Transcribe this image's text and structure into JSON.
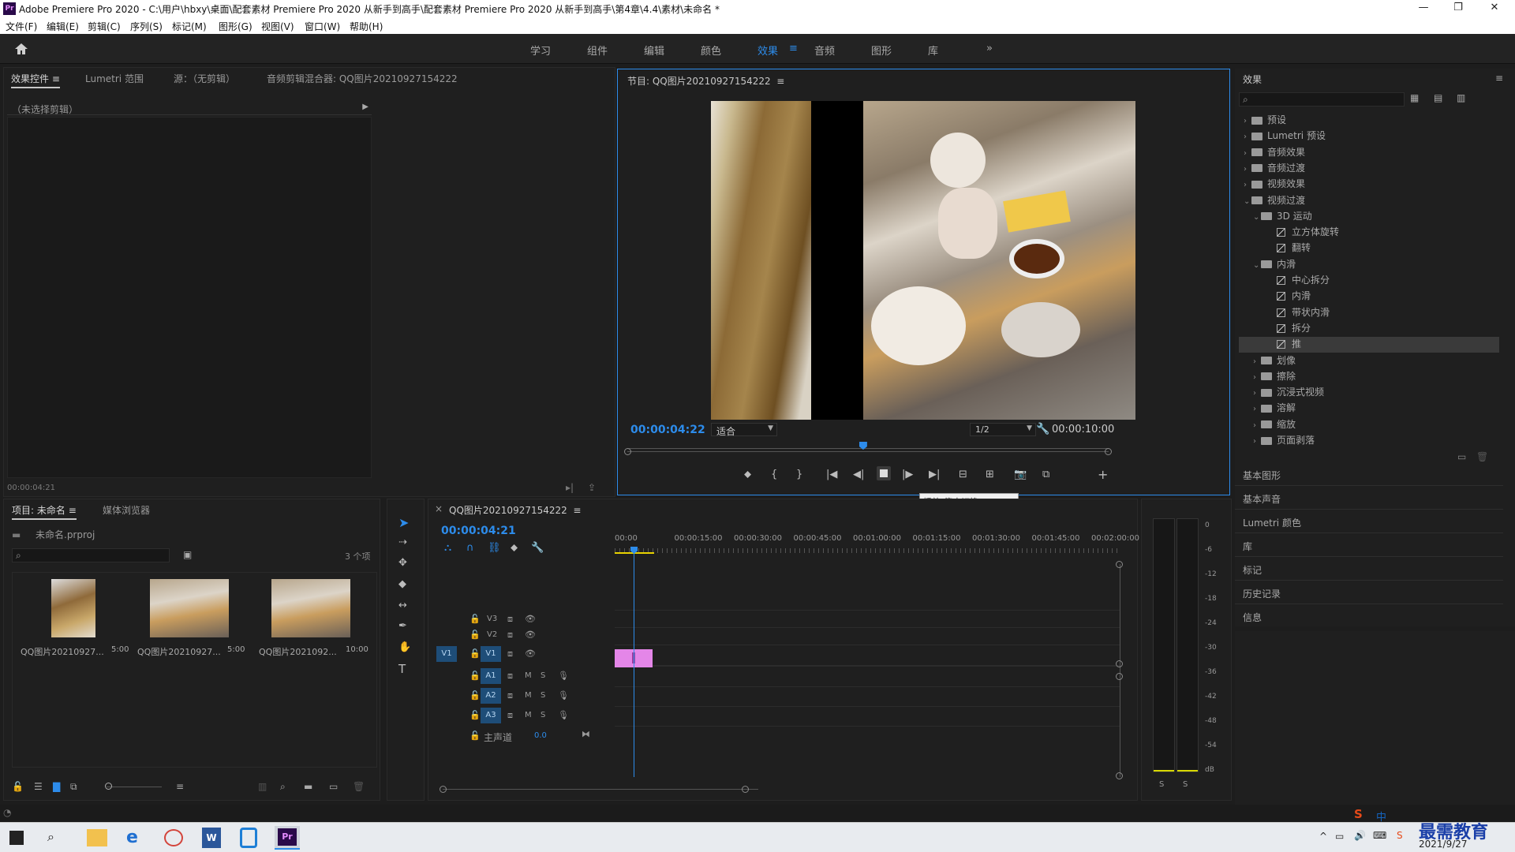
{
  "titlebar": {
    "title": "Adobe Premiere Pro 2020 - C:\\用户\\hbxy\\桌面\\配套素材 Premiere Pro 2020 从新手到高手\\配套素材 Premiere Pro 2020 从新手到高手\\第4章\\4.4\\素材\\未命名 *",
    "logo": "Pr",
    "minimize": "—",
    "restore": "❐",
    "close": "✕"
  },
  "menu": [
    "文件(F)",
    "编辑(E)",
    "剪辑(C)",
    "序列(S)",
    "标记(M)",
    "图形(G)",
    "视图(V)",
    "窗口(W)",
    "帮助(H)"
  ],
  "workspaces": {
    "home_icon": "home-icon",
    "items": [
      "学习",
      "组件",
      "编辑",
      "颜色",
      "效果",
      "音频",
      "图形",
      "库"
    ],
    "active": "效果",
    "overflow": "»",
    "menu_glyph": "≡"
  },
  "left_panel": {
    "tabs": [
      "效果控件",
      "Lumetri 范围",
      "源：（无剪辑）",
      "音频剪辑混合器: QQ图片20210927154222"
    ],
    "menu_glyph": "≡",
    "no_clip": "（未选择剪辑）",
    "timecode": "00:00:04:21"
  },
  "program_monitor": {
    "title": "节目: QQ图片20210927154222",
    "menu_glyph": "≡",
    "current_time": "00:00:04:22",
    "fit": "适合",
    "resolution": "1/2",
    "duration": "00:00:10:00",
    "playhead_fraction": 0.49,
    "tooltip": "播放-停止切换 (Space)"
  },
  "effects_panel": {
    "title": "效果",
    "menu_glyph": "≡",
    "tree": [
      {
        "label": "预设",
        "level": 0,
        "type": "folder-special",
        "expanded": false
      },
      {
        "label": "Lumetri 预设",
        "level": 0,
        "type": "folder-special",
        "expanded": false
      },
      {
        "label": "音频效果",
        "level": 0,
        "type": "folder",
        "expanded": false
      },
      {
        "label": "音频过渡",
        "level": 0,
        "type": "folder",
        "expanded": false
      },
      {
        "label": "视频效果",
        "level": 0,
        "type": "folder",
        "expanded": false
      },
      {
        "label": "视频过渡",
        "level": 0,
        "type": "folder",
        "expanded": true
      },
      {
        "label": "3D 运动",
        "level": 1,
        "type": "folder",
        "expanded": true
      },
      {
        "label": "立方体旋转",
        "level": 2,
        "type": "fx"
      },
      {
        "label": "翻转",
        "level": 2,
        "type": "fx"
      },
      {
        "label": "内滑",
        "level": 1,
        "type": "folder",
        "expanded": true
      },
      {
        "label": "中心拆分",
        "level": 2,
        "type": "fx"
      },
      {
        "label": "内滑",
        "level": 2,
        "type": "fx"
      },
      {
        "label": "带状内滑",
        "level": 2,
        "type": "fx"
      },
      {
        "label": "拆分",
        "level": 2,
        "type": "fx"
      },
      {
        "label": "推",
        "level": 2,
        "type": "fx",
        "selected": true
      },
      {
        "label": "划像",
        "level": 1,
        "type": "folder",
        "expanded": false
      },
      {
        "label": "擦除",
        "level": 1,
        "type": "folder",
        "expanded": false
      },
      {
        "label": "沉浸式视频",
        "level": 1,
        "type": "folder",
        "expanded": false
      },
      {
        "label": "溶解",
        "level": 1,
        "type": "folder",
        "expanded": false
      },
      {
        "label": "缩放",
        "level": 1,
        "type": "folder",
        "expanded": false
      },
      {
        "label": "页面剥落",
        "level": 1,
        "type": "folder",
        "expanded": false
      }
    ],
    "sections": [
      "基本图形",
      "基本声音",
      "Lumetri 颜色",
      "库",
      "标记",
      "历史记录",
      "信息"
    ]
  },
  "project_panel": {
    "tabs": [
      "项目: 未命名",
      "媒体浏览器"
    ],
    "menu_glyph": "≡",
    "project_file": "未命名.prproj",
    "count": "3 个项",
    "items": [
      {
        "name": "QQ图片20210927...",
        "duration": "5:00"
      },
      {
        "name": "QQ图片20210927...",
        "duration": "5:00"
      },
      {
        "name": "QQ图片2021092...",
        "duration": "10:00"
      }
    ]
  },
  "timeline": {
    "close_glyph": "×",
    "sequence": "QQ图片20210927154222",
    "menu_glyph": "≡",
    "timecode": "00:00:04:21",
    "ruler": [
      "00:00",
      "00:00:15:00",
      "00:00:30:00",
      "00:00:45:00",
      "00:01:00:00",
      "00:01:15:00",
      "00:01:30:00",
      "00:01:45:00",
      "00:02:00:00"
    ],
    "video_tracks": [
      "V3",
      "V2",
      "V1"
    ],
    "source_patch": "V1",
    "audio_tracks": [
      "A1",
      "A2",
      "A3"
    ],
    "mute": "M",
    "solo": "S",
    "master": "主声道",
    "master_value": "0.0"
  },
  "audio_meter": {
    "scale": [
      "0",
      "-6",
      "-12",
      "-18",
      "-24",
      "-30",
      "-36",
      "-42",
      "-48",
      "-54",
      "dB"
    ],
    "solo_left": "S",
    "solo_right": "S"
  },
  "taskbar": {
    "date": "2021/9/27",
    "watermark": "最需教育",
    "ime": "中"
  },
  "colors": {
    "accent": "#2d8ceb",
    "clip": "#e486e8",
    "playhead": "#2d8ceb",
    "selected_row": "#3a3a3a"
  }
}
